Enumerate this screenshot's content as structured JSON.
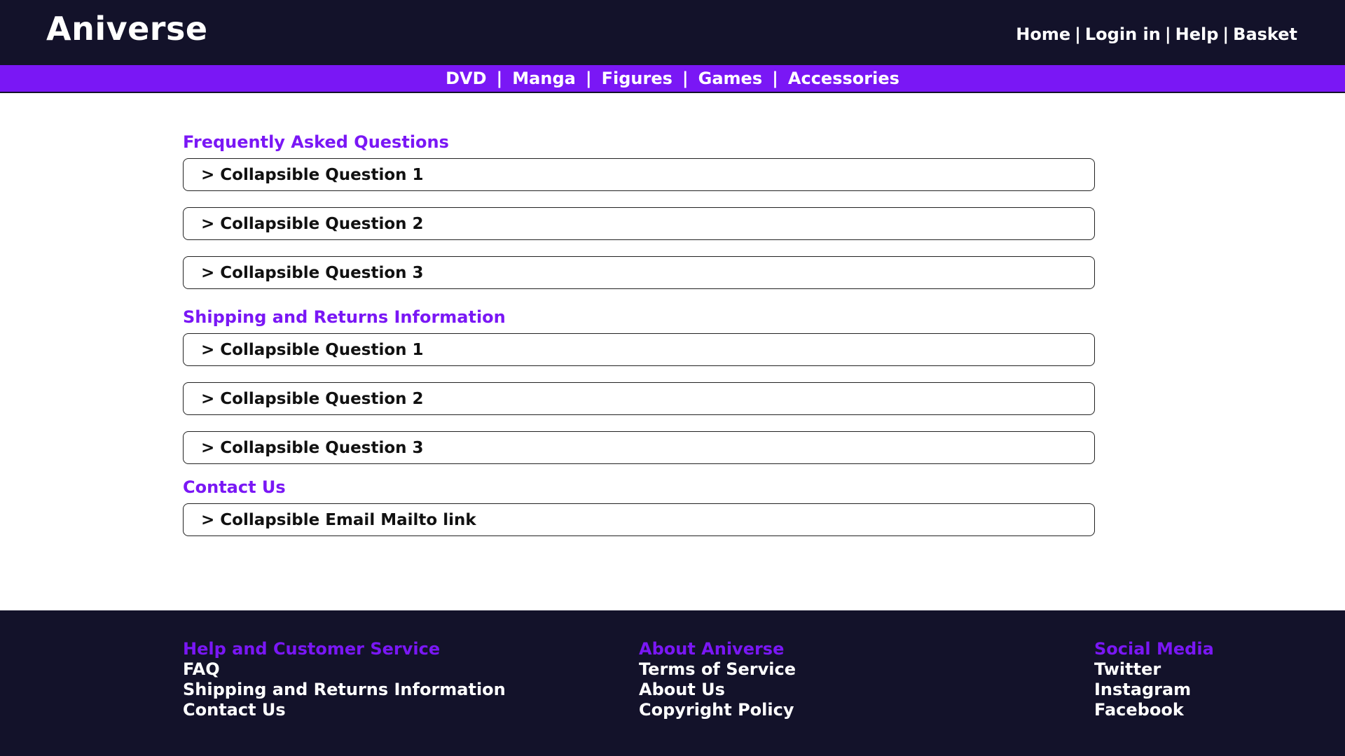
{
  "header": {
    "logo": "Aniverse",
    "links": [
      "Home",
      "Login in",
      "Help",
      "Basket"
    ],
    "separator": "|"
  },
  "nav": {
    "items": [
      "DVD",
      "Manga",
      "Figures",
      "Games",
      "Accessories"
    ],
    "separator": "|"
  },
  "sections": [
    {
      "title": "Frequently Asked Questions",
      "items": [
        "> Collapsible Question 1",
        "> Collapsible Question 2",
        "> Collapsible Question 3"
      ]
    },
    {
      "title": "Shipping and Returns Information",
      "items": [
        "> Collapsible Question 1",
        "> Collapsible Question 2",
        "> Collapsible Question 3"
      ]
    },
    {
      "title": "Contact Us",
      "items": [
        "> Collapsible Email Mailto link"
      ]
    }
  ],
  "footer": {
    "columns": [
      {
        "title": "Help and Customer Service",
        "links": [
          "FAQ",
          "Shipping and Returns Information",
          "Contact Us"
        ]
      },
      {
        "title": "About Aniverse",
        "links": [
          "Terms of Service",
          "About Us",
          "Copyright Policy"
        ]
      },
      {
        "title": "Social Media",
        "links": [
          "Twitter",
          "Instagram",
          "Facebook"
        ]
      }
    ]
  },
  "colors": {
    "dark": "#13122a",
    "accent": "#7a17f5",
    "text_light": "#ffffff"
  }
}
